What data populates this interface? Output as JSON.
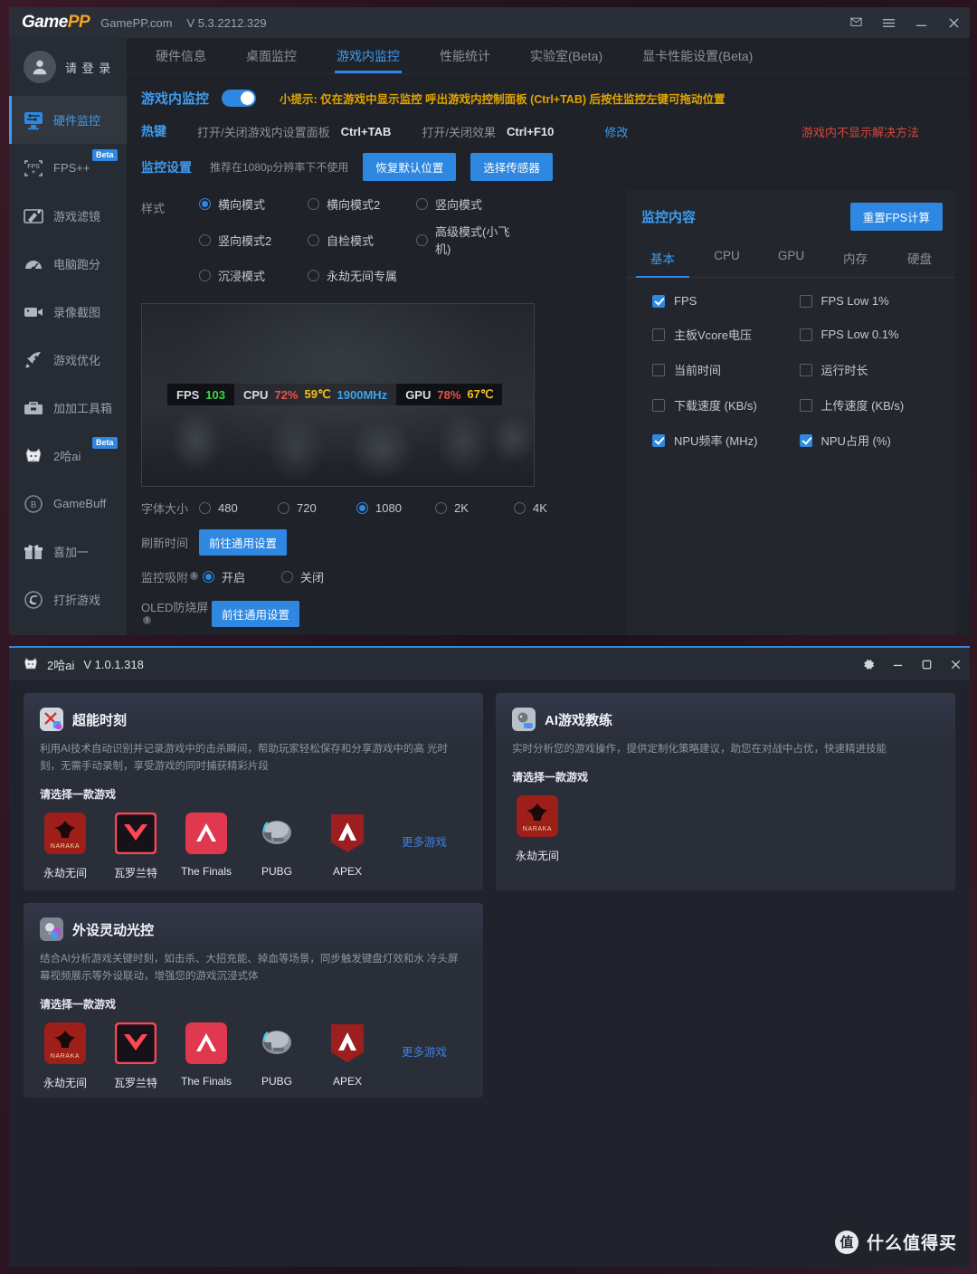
{
  "gamepp": {
    "titlebar": {
      "logo_game": "Game",
      "logo_pp": "PP",
      "site": "GamePP.com",
      "version": "V 5.3.2212.329",
      "mail_icon": "mail-icon",
      "menu_icon": "hamburger-menu-icon",
      "minimize_icon": "minimize-icon",
      "close_icon": "close-icon"
    },
    "user": {
      "label": "请 登 录",
      "avatar_icon": "user-avatar-icon"
    },
    "sidebar": [
      {
        "label": "硬件监控",
        "icon": "hardware-monitor-icon",
        "active": true,
        "beta": ""
      },
      {
        "label": "FPS++",
        "icon": "fps-plus-icon",
        "active": false,
        "beta": "Beta"
      },
      {
        "label": "游戏滤镜",
        "icon": "game-filter-icon",
        "active": false,
        "beta": ""
      },
      {
        "label": "电脑跑分",
        "icon": "benchmark-gauge-icon",
        "active": false,
        "beta": ""
      },
      {
        "label": "录像截图",
        "icon": "camcorder-icon",
        "active": false,
        "beta": ""
      },
      {
        "label": "游戏优化",
        "icon": "rocket-icon",
        "active": false,
        "beta": ""
      },
      {
        "label": "加加工具箱",
        "icon": "toolbox-icon",
        "active": false,
        "beta": ""
      },
      {
        "label": "2哈ai",
        "icon": "husky-dog-icon",
        "active": false,
        "beta": "Beta"
      },
      {
        "label": "GameBuff",
        "icon": "gamebuff-icon",
        "active": false,
        "beta": ""
      },
      {
        "label": "喜加一",
        "icon": "gift-icon",
        "active": false,
        "beta": ""
      },
      {
        "label": "打折游戏",
        "icon": "discount-icon",
        "active": false,
        "beta": ""
      }
    ],
    "tabs": [
      {
        "label": "硬件信息",
        "active": false
      },
      {
        "label": "桌面监控",
        "active": false
      },
      {
        "label": "游戏内监控",
        "active": true
      },
      {
        "label": "性能统计",
        "active": false
      },
      {
        "label": "实验室(Beta)",
        "active": false
      },
      {
        "label": "显卡性能设置(Beta)",
        "active": false
      }
    ],
    "ingame": {
      "title": "游戏内监控",
      "toggle_on": true,
      "hint": "小提示: 仅在游戏中显示监控 呼出游戏内控制面板 (Ctrl+TAB) 后按住监控左键可拖动位置"
    },
    "hotkey": {
      "label": "热键",
      "item1_label": "打开/关闭游戏内设置面板",
      "item1_key": "Ctrl+TAB",
      "item2_label": "打开/关闭效果",
      "item2_key": "Ctrl+F10",
      "modify": "修改",
      "warning": "游戏内不显示解决方法"
    },
    "monitor_settings": {
      "label": "监控设置",
      "note": "推荐在1080p分辨率下不使用",
      "btn_restore": "恢复默认位置",
      "btn_sensor": "选择传感器"
    },
    "style": {
      "label": "样式",
      "options": [
        {
          "label": "横向模式",
          "selected": true
        },
        {
          "label": "横向模式2",
          "selected": false
        },
        {
          "label": "竖向模式",
          "selected": false
        },
        {
          "label": "竖向模式2",
          "selected": false
        },
        {
          "label": "自检模式",
          "selected": false
        },
        {
          "label": "高级模式(小飞机)",
          "selected": false
        },
        {
          "label": "沉浸模式",
          "selected": false
        },
        {
          "label": "永劫无间专属",
          "selected": false
        }
      ]
    },
    "osd_preview": {
      "fps_label": "FPS",
      "fps_value": "103",
      "cpu_label": "CPU",
      "cpu_usage": "72%",
      "cpu_temp": "59℃",
      "cpu_clock": "1900MHz",
      "gpu_label": "GPU",
      "gpu_usage": "78%",
      "gpu_temp": "67℃",
      "colors": {
        "green": "#3fd34a",
        "red": "#e8544a",
        "yellow": "#f2c21a",
        "blue": "#3da4f0"
      }
    },
    "font_size": {
      "label": "字体大小",
      "options": [
        {
          "label": "480",
          "selected": false
        },
        {
          "label": "720",
          "selected": false
        },
        {
          "label": "1080",
          "selected": true
        },
        {
          "label": "2K",
          "selected": false
        },
        {
          "label": "4K",
          "selected": false
        }
      ]
    },
    "refresh_time": {
      "label": "刷新时间",
      "btn": "前往通用设置"
    },
    "monitor_attach": {
      "label": "监控吸附",
      "options": [
        {
          "label": "开启",
          "selected": true
        },
        {
          "label": "关闭",
          "selected": false
        }
      ]
    },
    "oled": {
      "label": "OLED防烧屏",
      "btn": "前往通用设置"
    },
    "monitor_content": {
      "title": "监控内容",
      "btn_reset": "重置FPS计算",
      "tabs": [
        {
          "label": "基本",
          "active": true
        },
        {
          "label": "CPU",
          "active": false
        },
        {
          "label": "GPU",
          "active": false
        },
        {
          "label": "内存",
          "active": false
        },
        {
          "label": "硬盘",
          "active": false
        }
      ],
      "checkboxes": [
        {
          "label": "FPS",
          "checked": true
        },
        {
          "label": "FPS Low 1%",
          "checked": false
        },
        {
          "label": "主板Vcore电压",
          "checked": false
        },
        {
          "label": "FPS Low 0.1%",
          "checked": false
        },
        {
          "label": "当前时间",
          "checked": false
        },
        {
          "label": "运行时长",
          "checked": false
        },
        {
          "label": "下载速度 (KB/s)",
          "checked": false
        },
        {
          "label": "上传速度 (KB/s)",
          "checked": false
        },
        {
          "label": "NPU频率 (MHz)",
          "checked": true
        },
        {
          "label": "NPU占用 (%)",
          "checked": true
        }
      ]
    }
  },
  "haai": {
    "titlebar": {
      "logo_icon": "husky-dog-icon",
      "name": "2哈ai",
      "version": "V 1.0.1.318",
      "settings_icon": "gear-icon",
      "minimize_icon": "minimize-icon",
      "maximize_icon": "maximize-icon",
      "close_icon": "close-icon"
    },
    "cards": [
      {
        "title": "超能时刻",
        "icon": "super-moment-icon",
        "desc": "利用AI技术自动识别并记录游戏中的击杀瞬间，帮助玩家轻松保存和分享游戏中的高 光时刻，无需手动录制，享受游戏的同时捕获精彩片段",
        "sub": "请选择一款游戏",
        "more": "更多游戏",
        "games": [
          {
            "label": "永劫无间",
            "icon": "naraka-icon"
          },
          {
            "label": "瓦罗兰特",
            "icon": "valorant-icon"
          },
          {
            "label": "The Finals",
            "icon": "the-finals-icon"
          },
          {
            "label": "PUBG",
            "icon": "pubg-icon"
          },
          {
            "label": "APEX",
            "icon": "apex-icon"
          }
        ]
      },
      {
        "title": "AI游戏教练",
        "icon": "ai-coach-icon",
        "desc": "实时分析您的游戏操作，提供定制化策略建议，助您在对战中占优，快速精进技能",
        "sub": "请选择一款游戏",
        "more": "",
        "games": [
          {
            "label": "永劫无间",
            "icon": "naraka-icon"
          }
        ]
      },
      {
        "title": "外设灵动光控",
        "icon": "rgb-light-icon",
        "desc": "结合AI分析游戏关键时刻，如击杀、大招充能、掉血等场景，同步触发键盘灯效和水 冷头屏幕视频展示等外设联动，增强您的游戏沉浸式体",
        "sub": "请选择一款游戏",
        "more": "更多游戏",
        "games": [
          {
            "label": "永劫无间",
            "icon": "naraka-icon"
          },
          {
            "label": "瓦罗兰特",
            "icon": "valorant-icon"
          },
          {
            "label": "The Finals",
            "icon": "the-finals-icon"
          },
          {
            "label": "PUBG",
            "icon": "pubg-icon"
          },
          {
            "label": "APEX",
            "icon": "apex-icon"
          }
        ]
      }
    ]
  },
  "watermark": {
    "mark": "值",
    "text": "什么值得买"
  }
}
